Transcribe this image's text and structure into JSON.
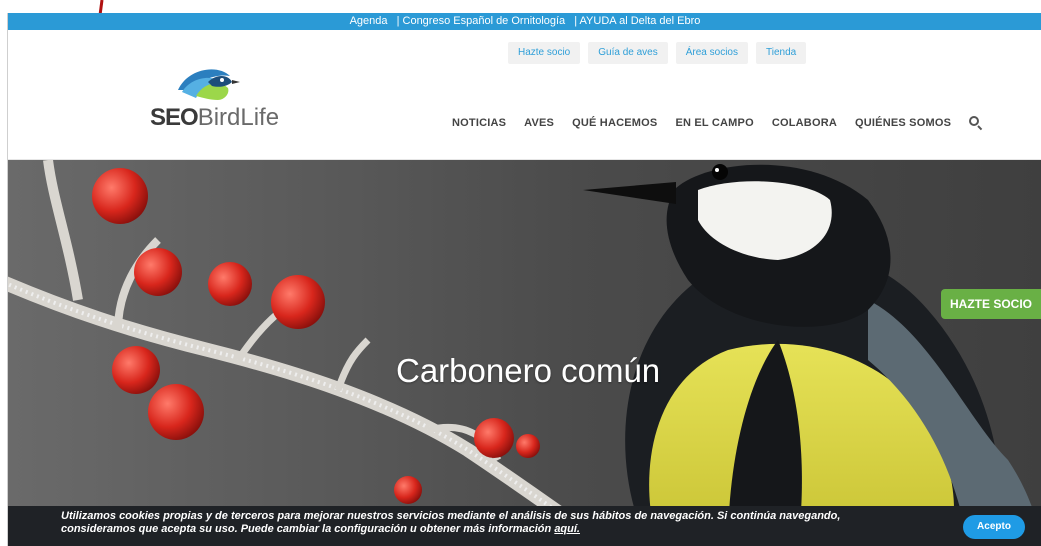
{
  "topbar": {
    "links": [
      "Agenda",
      "| Congreso Español de Ornitología",
      "| AYUDA al Delta del Ebro"
    ]
  },
  "secondary_nav": [
    "Hazte socio",
    "Guía de aves",
    "Área socios",
    "Tienda"
  ],
  "logo": {
    "brand_bold": "SEO",
    "brand_light": "BirdLife"
  },
  "main_nav": [
    "NOTICIAS",
    "AVES",
    "QUÉ HACEMOS",
    "EN EL CAMPO",
    "COLABORA",
    "QUIÉNES SOMOS"
  ],
  "hero": {
    "title": "Carbonero común"
  },
  "side_cta": "HAZTE SOCIO",
  "cookie": {
    "text_line1": "Utilizamos cookies propias y de terceros para mejorar nuestros servicios mediante el análisis de sus hábitos de navegación. Si continúa navegando,",
    "text_line2": "consideramos que acepta su uso. Puede cambiar la configuración u obtener más información",
    "link": "aquí.",
    "button": "Acepto"
  },
  "colors": {
    "topbar": "#2b9ad6",
    "accent_green": "#69b045",
    "cookie_bg": "#1f2226",
    "accept_blue": "#1f9be5",
    "arrow_red": "#b01010"
  },
  "icons": {
    "search": "search-icon",
    "annotation": "red-arrow-icon"
  }
}
